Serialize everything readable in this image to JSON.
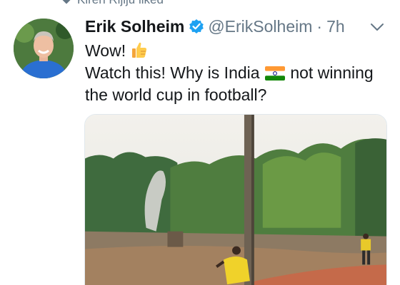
{
  "social_context": {
    "text": "Kiren Rijiju liked",
    "icon": "heart-icon"
  },
  "tweet": {
    "author_name": "Erik Solheim",
    "handle": "@ErikSolheim",
    "separator": "·",
    "time": "7h",
    "verified": true,
    "text_line1": "Wow!",
    "text_line2_before": "Watch this! Why is India",
    "text_line2_after": "not winning",
    "text_line3": "the world cup in football?",
    "emojis": [
      "thumbs-up-emoji",
      "india-flag-emoji"
    ]
  },
  "colors": {
    "secondary_text": "#657786",
    "verified_blue": "#1da1f2",
    "primary_text": "#14171a"
  }
}
